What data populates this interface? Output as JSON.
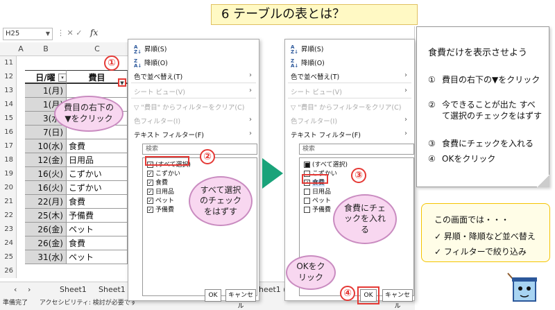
{
  "title": "6 テーブルの表とは？",
  "excel": {
    "name_box": "H25",
    "fx_label": "fx",
    "columns": [
      "A",
      "B",
      "C"
    ],
    "header_row": {
      "date": "日/曜",
      "cost": "費目"
    },
    "row_numbers": [
      "11",
      "12",
      "13",
      "14",
      "15",
      "16",
      "17",
      "18",
      "19",
      "20",
      "21",
      "22",
      "23",
      "24",
      "25",
      "26"
    ],
    "rows": [
      {
        "date": "1(月)",
        "cost": ""
      },
      {
        "date": "1(月)",
        "cost": ""
      },
      {
        "date": "3(水)",
        "cost": ""
      },
      {
        "date": "7(日)",
        "cost": ""
      },
      {
        "date": "10(水)",
        "cost": "食費"
      },
      {
        "date": "12(金)",
        "cost": "日用品"
      },
      {
        "date": "16(火)",
        "cost": "こずかい"
      },
      {
        "date": "16(火)",
        "cost": "こずかい"
      },
      {
        "date": "22(月)",
        "cost": "食費"
      },
      {
        "date": "25(木)",
        "cost": "予備費"
      },
      {
        "date": "26(金)",
        "cost": "ペット"
      },
      {
        "date": "26(金)",
        "cost": "食費"
      },
      {
        "date": "31(水)",
        "cost": "ペット"
      }
    ],
    "sheet_tabs": [
      "Sheet1",
      "Sheet1 (",
      "Sheet1 ("
    ],
    "status_left": "準備完了",
    "status_access": "アクセシビリティ: 検討が必要です"
  },
  "menu": {
    "sort_asc": "昇順(S)",
    "sort_desc": "降順(O)",
    "color_sort": "色で並べ替え(T)",
    "sheet_view": "シート ビュー(V)",
    "clear_filter": "\"費目\" からフィルターをクリア(C)",
    "color_filter": "色フィルター(I)",
    "text_filter": "テキスト フィルター(F)",
    "search_placeholder": "検索",
    "select_all": "(すべて選択)",
    "items": [
      "こずかい",
      "食費",
      "日用品",
      "ペット",
      "予備費"
    ],
    "ok": "OK",
    "cancel": "キャンセル"
  },
  "callouts": {
    "n1": "①",
    "n2": "②",
    "n3": "③",
    "n4": "④",
    "b1": "費目の右下の▼をクリック",
    "b2": "すべて選択のチェックをはずす",
    "b3": "食費にチェックを入れる",
    "b4": "OKをクリック"
  },
  "steps": {
    "head": "食費だけを表示させよう",
    "list": [
      {
        "n": "①",
        "t": "費目の右下の▼をクリック"
      },
      {
        "n": "②",
        "t": "今できることが出た すべて選択のチェックをはずす"
      },
      {
        "n": "③",
        "t": "食費にチェックを入れる"
      },
      {
        "n": "④",
        "t": "OKをクリック"
      }
    ]
  },
  "note": {
    "head": "この画面では・・・",
    "items": [
      "昇順・降順など並べ替え",
      "フィルターで絞り込み"
    ]
  },
  "colors": {
    "accent_red": "#e53935",
    "bubble": "#f8d7f0",
    "arrow": "#1aa37a",
    "title_bg": "#fff9c4"
  }
}
